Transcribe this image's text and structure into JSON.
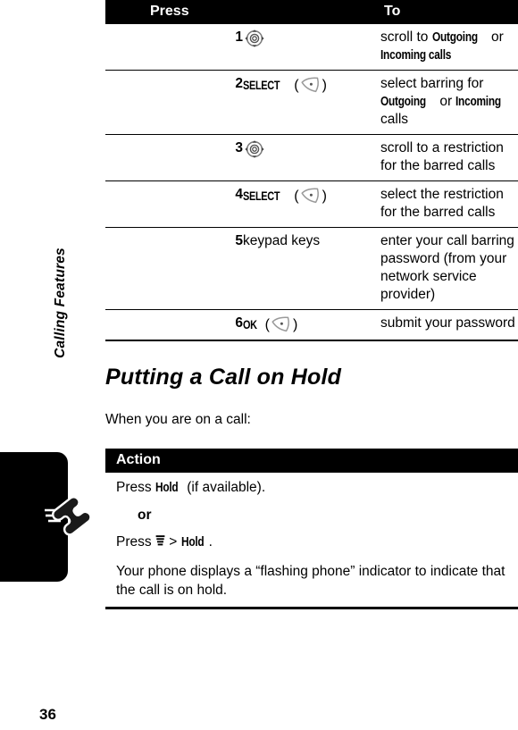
{
  "page": {
    "folio": "36",
    "chapter_label": "Calling Features",
    "tab_icon": "phone-handset-ringing-icon"
  },
  "call_barring_table": {
    "headers": {
      "press": "Press",
      "to": "To"
    },
    "rows": [
      {
        "num": "1",
        "press_icon": "navigation-key-icon",
        "press_label": "",
        "press_key_icon": "",
        "to_parts": [
          {
            "t": "scroll to ",
            "b": false
          },
          {
            "t": "Outgoing",
            "b": true
          },
          {
            "t": " or ",
            "b": false
          },
          {
            "t": "Incoming calls",
            "b": true
          }
        ]
      },
      {
        "num": "2",
        "press_icon": "",
        "press_label": "SELECT",
        "press_key_icon": "soft-key-icon",
        "to_parts": [
          {
            "t": "select barring for ",
            "b": false
          },
          {
            "t": "Outgoing",
            "b": true
          },
          {
            "t": " or ",
            "b": false
          },
          {
            "t": "Incoming",
            "b": true
          },
          {
            "t": " calls",
            "b": false
          }
        ]
      },
      {
        "num": "3",
        "press_icon": "navigation-key-icon",
        "press_label": "",
        "press_key_icon": "",
        "to_parts": [
          {
            "t": "scroll to a restriction for the barred calls",
            "b": false
          }
        ]
      },
      {
        "num": "4",
        "press_icon": "",
        "press_label": "SELECT",
        "press_key_icon": "soft-key-icon",
        "to_parts": [
          {
            "t": "select the restriction for the barred calls",
            "b": false
          }
        ]
      },
      {
        "num": "5",
        "press_icon": "",
        "press_label": "",
        "press_text": "keypad keys",
        "press_key_icon": "",
        "to_parts": [
          {
            "t": "enter your call barring password (from your network service provider)",
            "b": false
          }
        ]
      },
      {
        "num": "6",
        "press_icon": "",
        "press_label": "OK",
        "press_key_icon": "soft-key-icon",
        "to_parts": [
          {
            "t": "submit your password",
            "b": false
          }
        ]
      }
    ]
  },
  "section": {
    "title": "Putting a Call on Hold",
    "intro": "When you are on a call:"
  },
  "action_table": {
    "header": "Action",
    "line1_parts": [
      {
        "t": "Press ",
        "b": false
      },
      {
        "t": "Hold",
        "b": true
      },
      {
        "t": " (if available).",
        "b": false
      }
    ],
    "or_label": "or",
    "line2_prefix": "Press ",
    "line2_icon": "menu-key-icon",
    "line2_middle": " > ",
    "line2_keyword": "Hold",
    "line2_suffix": ".",
    "line3": "Your phone displays a “flashing phone” indicator to indicate that the call is on hold."
  }
}
